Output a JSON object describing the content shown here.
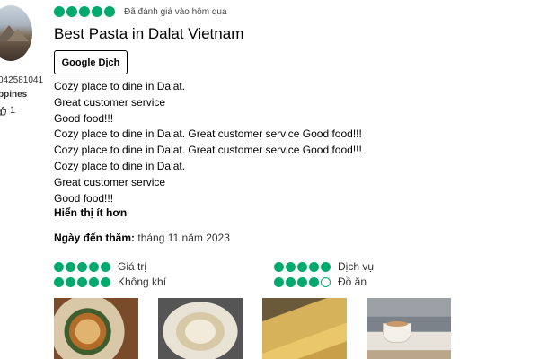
{
  "user": {
    "id_fragment": "042581041",
    "location_fragment": "ppines",
    "contributions": "1"
  },
  "review": {
    "rating": 5,
    "rated_date": "Đã đánh giá vào hôm qua",
    "title": "Best Pasta in Dalat Vietnam",
    "translate_label": "Google Dịch",
    "lines": [
      "Cozy place to dine in Dalat.",
      "Great customer service",
      "Good food!!!",
      "Cozy place to dine in Dalat. Great customer service Good food!!!",
      "Cozy place to dine in Dalat. Great customer service Good food!!!",
      "Cozy place to dine in Dalat.",
      "Great customer service",
      "Good food!!!"
    ],
    "show_less_label": "Hiển thị ít hơn",
    "visit_label": "Ngày đến thăm:",
    "visit_date": "tháng 11 năm 2023"
  },
  "sub_ratings": [
    {
      "label": "Giá trị",
      "value": 5
    },
    {
      "label": "Dịch vụ",
      "value": 5
    },
    {
      "label": "Không khí",
      "value": 5
    },
    {
      "label": "Đồ ăn",
      "value": 4
    }
  ],
  "colors": {
    "bubble_green": "#00aa6c"
  },
  "photos": [
    {
      "icon": "burger-plate-photo"
    },
    {
      "icon": "pasta-plate-photo"
    },
    {
      "icon": "baked-bread-photo"
    },
    {
      "icon": "coffee-cup-photo"
    }
  ]
}
